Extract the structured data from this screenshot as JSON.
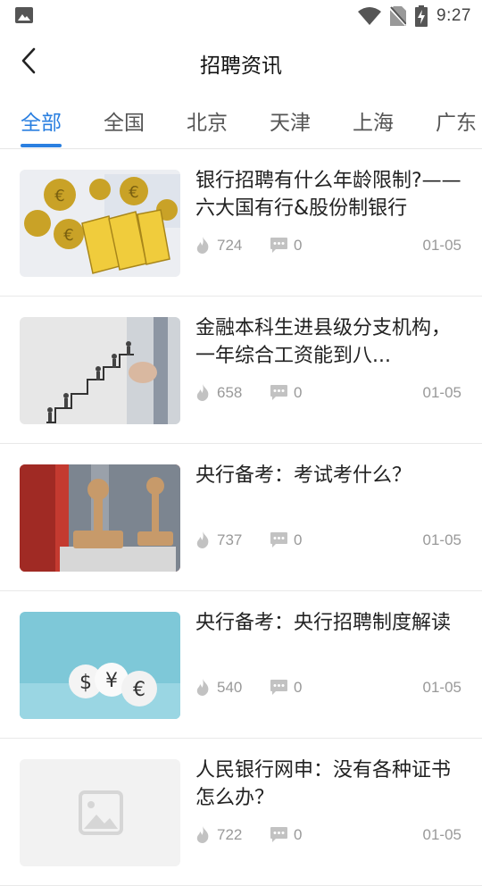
{
  "status_bar": {
    "time": "9:27"
  },
  "header": {
    "title": "招聘资讯"
  },
  "tabs": [
    {
      "label": "全部",
      "active": true
    },
    {
      "label": "全国",
      "active": false
    },
    {
      "label": "北京",
      "active": false
    },
    {
      "label": "天津",
      "active": false
    },
    {
      "label": "上海",
      "active": false
    },
    {
      "label": "广东",
      "active": false
    }
  ],
  "colors": {
    "accent": "#2a7fe0",
    "meta": "#999999",
    "divider": "#e9e9e9"
  },
  "articles": [
    {
      "title": "银行招聘有什么年龄限制?——六大国有行&股份制银行",
      "views": "724",
      "comments": "0",
      "date": "01-05",
      "image": "euro-coins-gold-bars"
    },
    {
      "title": "金融本科生进县级分支机构，一年综合工资能到八...",
      "views": "658",
      "comments": "0",
      "date": "01-05",
      "image": "stairs-figures"
    },
    {
      "title": "央行备考：考试考什么？",
      "views": "737",
      "comments": "0",
      "date": "01-05",
      "image": "rubber-stamps"
    },
    {
      "title": "央行备考：央行招聘制度解读",
      "views": "540",
      "comments": "0",
      "date": "01-05",
      "image": "currency-balls"
    },
    {
      "title": "人民银行网申：没有各种证书怎么办？",
      "views": "722",
      "comments": "0",
      "date": "01-05",
      "image": "image-placeholder"
    }
  ]
}
